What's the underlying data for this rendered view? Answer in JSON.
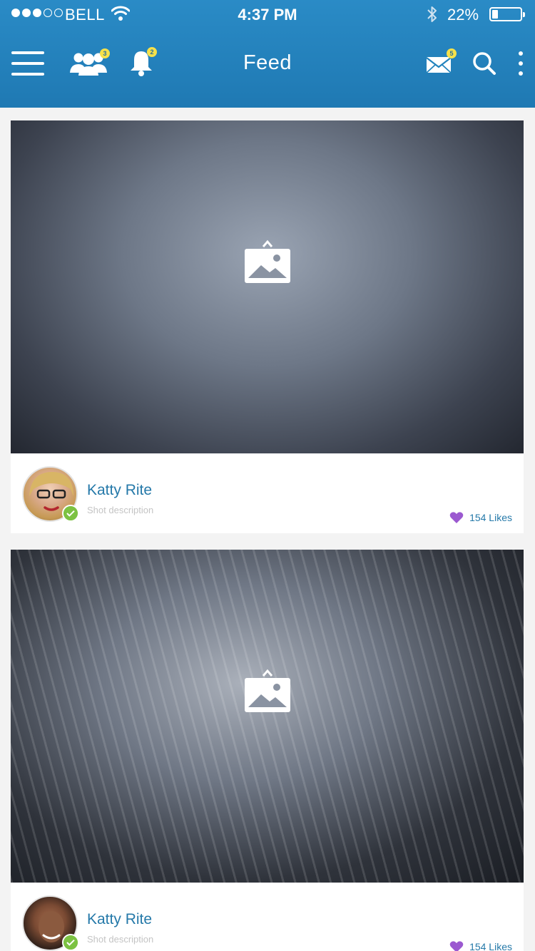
{
  "status_bar": {
    "carrier": "BELL",
    "time": "4:37 PM",
    "battery_percent": "22%",
    "battery_level": 0.22,
    "signal_bars_filled": 3,
    "signal_bars_total": 5
  },
  "nav": {
    "title": "Feed",
    "friends_badge": "3",
    "notifications_badge": "2",
    "messages_badge": "5",
    "icons": [
      "menu-icon",
      "friends-icon",
      "bell-icon",
      "mail-icon",
      "search-icon",
      "more-icon"
    ]
  },
  "feed": [
    {
      "user_name": "Katty Rite",
      "description": "Shot description",
      "likes": "154 Likes"
    },
    {
      "user_name": "Katty Rite",
      "description": "Shot description",
      "likes": "154 Likes"
    }
  ],
  "colors": {
    "header": "#2a8bc6",
    "accent_text": "#2579a9",
    "badge": "#f6e14a",
    "heart": "#9b59d0",
    "verified": "#7cc242"
  }
}
